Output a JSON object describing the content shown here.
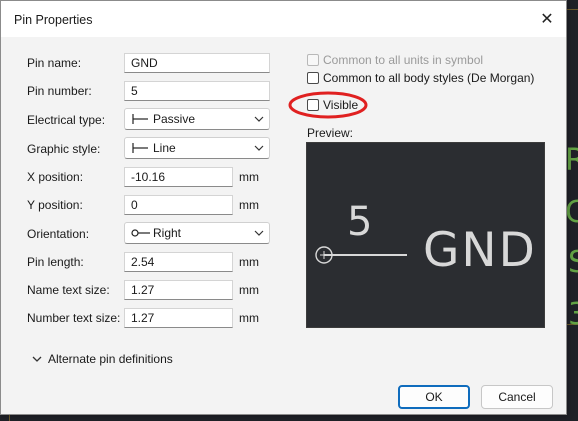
{
  "dialog": {
    "title": "Pin Properties",
    "close_glyph": "✕"
  },
  "fields": {
    "pin_name": {
      "label": "Pin name:",
      "value": "GND"
    },
    "pin_number": {
      "label": "Pin number:",
      "value": "5"
    },
    "electrical_type": {
      "label": "Electrical type:",
      "value": "Passive",
      "icon": "passive-pin-icon"
    },
    "graphic_style": {
      "label": "Graphic style:",
      "value": "Line",
      "icon": "line-style-icon"
    },
    "x_position": {
      "label": "X position:",
      "value": "-10.16",
      "unit": "mm"
    },
    "y_position": {
      "label": "Y position:",
      "value": "0",
      "unit": "mm"
    },
    "orientation": {
      "label": "Orientation:",
      "value": "Right",
      "icon": "orientation-right-icon"
    },
    "pin_length": {
      "label": "Pin length:",
      "value": "2.54",
      "unit": "mm"
    },
    "name_text_size": {
      "label": "Name text size:",
      "value": "1.27",
      "unit": "mm"
    },
    "number_text_size": {
      "label": "Number text size:",
      "value": "1.27",
      "unit": "mm"
    }
  },
  "options": {
    "common_units": {
      "label": "Common to all units in symbol",
      "checked": false,
      "disabled": true
    },
    "common_body_styles": {
      "label": "Common to all body styles (De Morgan)",
      "checked": false,
      "disabled": false
    },
    "visible": {
      "label": "Visible",
      "checked": false,
      "disabled": false
    }
  },
  "preview": {
    "label": "Preview:",
    "pin_number": "5",
    "pin_name": "GND"
  },
  "alternate": {
    "label": "Alternate pin definitions"
  },
  "buttons": {
    "ok": "OK",
    "cancel": "Cancel"
  },
  "colors": {
    "accent": "#0f6cbd",
    "annotation": "#e02020",
    "preview_bg": "#2b2d31",
    "canvas_bg": "#1f2127"
  }
}
